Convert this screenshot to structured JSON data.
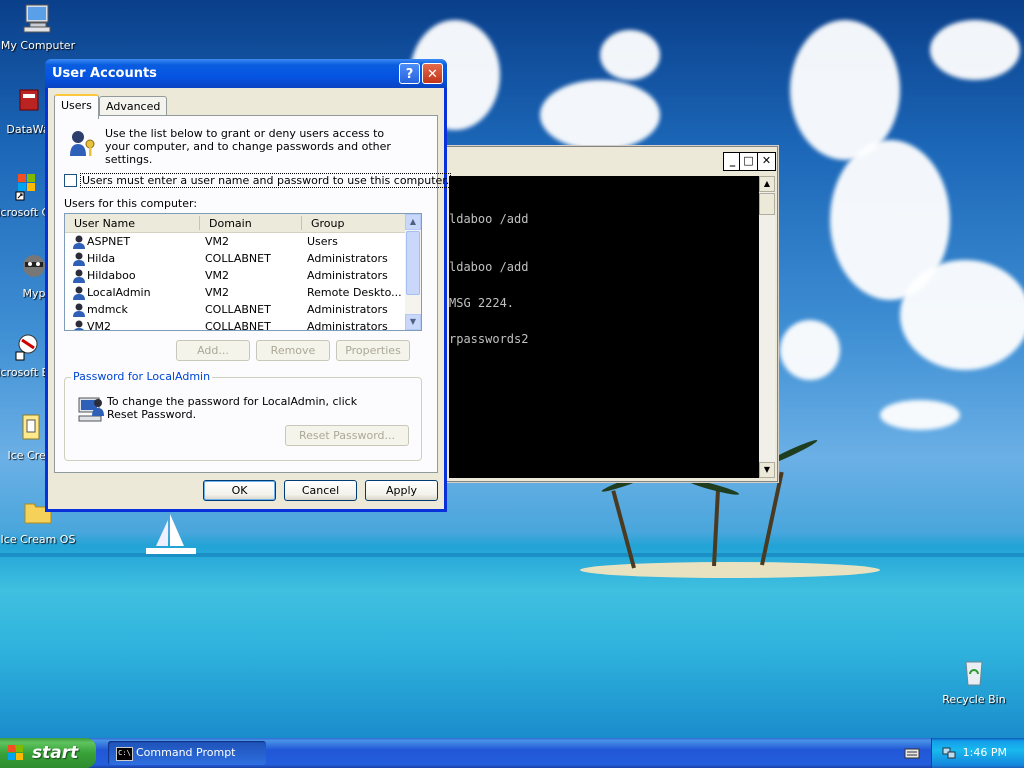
{
  "desktop_icons": [
    {
      "label": "My Computer",
      "icon": "computer-icon"
    },
    {
      "label": "DataWa",
      "icon": "app-icon"
    },
    {
      "label": "Microsoft C++",
      "icon": "shortcut-icon"
    },
    {
      "label": "Myp",
      "icon": "raccoon-icon"
    },
    {
      "label": "Microsoft Basic",
      "icon": "shortcut-icon"
    },
    {
      "label": "Ice Crea",
      "icon": "document-icon"
    },
    {
      "label": "Ice Cream OS",
      "icon": "folder-icon"
    },
    {
      "label": "Recycle Bin",
      "icon": "recycle-bin-icon"
    }
  ],
  "cmd": {
    "lines": [
      "ldaboo /add",
      "ldaboo /add",
      "MSG 2224.",
      "rpasswords2"
    ],
    "minimize": "_",
    "maximize": "□",
    "close": "✕"
  },
  "dialog": {
    "title": "User Accounts",
    "help_glyph": "?",
    "close_glyph": "✕",
    "tabs": [
      "Users",
      "Advanced"
    ],
    "info": "Use the list below to grant or deny users access to your computer, and to change passwords and other settings.",
    "checkbox_label": "Users must enter a user name and password to use this computer.",
    "checkbox_checked": false,
    "users_label": "Users for this computer:",
    "columns": [
      "User Name",
      "Domain",
      "Group"
    ],
    "rows": [
      {
        "name": "ASPNET",
        "domain": "VM2",
        "group": "Users"
      },
      {
        "name": "Hilda",
        "domain": "COLLABNET",
        "group": "Administrators"
      },
      {
        "name": "Hildaboo",
        "domain": "VM2",
        "group": "Administrators"
      },
      {
        "name": "LocalAdmin",
        "domain": "VM2",
        "group": "Remote Deskto..."
      },
      {
        "name": "mdmck",
        "domain": "COLLABNET",
        "group": "Administrators"
      },
      {
        "name": "VM2",
        "domain": "COLLABNET",
        "group": "Administrators"
      }
    ],
    "add_btn": "Add...",
    "remove_btn": "Remove",
    "properties_btn": "Properties",
    "group_title": "Password for LocalAdmin",
    "group_text": "To change the password for LocalAdmin, click Reset Password.",
    "reset_btn": "Reset Password...",
    "ok_btn": "OK",
    "cancel_btn": "Cancel",
    "apply_btn": "Apply"
  },
  "taskbar": {
    "start_label": "start",
    "task_label": "Command Prompt",
    "task_icon_text": "C:\\",
    "clock": "1:46 PM"
  },
  "colors": {
    "xp_blue": "#0831d9",
    "start_green": "#38a238",
    "dialog_face": "#ece9d8"
  }
}
